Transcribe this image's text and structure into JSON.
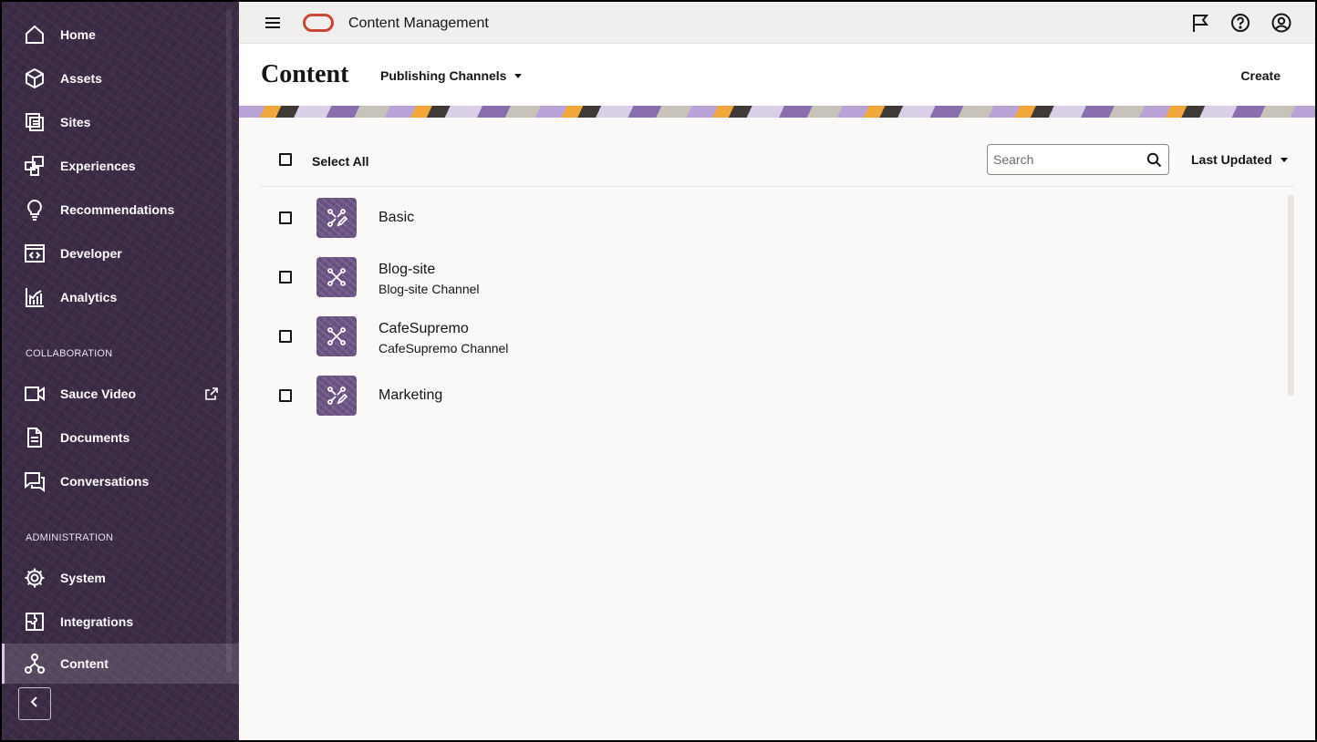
{
  "app": {
    "title": "Content Management"
  },
  "sidebar": {
    "items": [
      {
        "label": "Home",
        "icon": "home-icon"
      },
      {
        "label": "Assets",
        "icon": "cube-icon"
      },
      {
        "label": "Sites",
        "icon": "sites-icon"
      },
      {
        "label": "Experiences",
        "icon": "experiences-icon"
      },
      {
        "label": "Recommendations",
        "icon": "lightbulb-icon"
      },
      {
        "label": "Developer",
        "icon": "code-icon"
      },
      {
        "label": "Analytics",
        "icon": "bar-chart-icon"
      }
    ],
    "collaboration_header": "COLLABORATION",
    "collaboration": [
      {
        "label": "Sauce Video",
        "icon": "video-icon",
        "external": true
      },
      {
        "label": "Documents",
        "icon": "documents-icon"
      },
      {
        "label": "Conversations",
        "icon": "conversations-icon"
      }
    ],
    "administration_header": "ADMINISTRATION",
    "administration": [
      {
        "label": "System",
        "icon": "gear-icon"
      },
      {
        "label": "Integrations",
        "icon": "puzzle-icon"
      },
      {
        "label": "Content",
        "icon": "hierarchy-icon",
        "active": true
      }
    ]
  },
  "header": {
    "title": "Content",
    "view_selector": "Publishing Channels",
    "create_label": "Create"
  },
  "toolbar": {
    "select_all_label": "Select All",
    "search_placeholder": "Search",
    "search_value": "",
    "sort_label": "Last Updated"
  },
  "channels": [
    {
      "name": "Basic",
      "description": "",
      "icon": "channel-edit-icon"
    },
    {
      "name": "Blog-site",
      "description": "Blog-site Channel",
      "icon": "channel-icon"
    },
    {
      "name": "CafeSupremo",
      "description": "CafeSupremo Channel",
      "icon": "channel-icon"
    },
    {
      "name": "Marketing",
      "description": "",
      "icon": "channel-edit-icon"
    }
  ],
  "colors": {
    "sidebar_bg": "#3b2b45",
    "oracle_red": "#c74634",
    "thumb_bg": "#6b5384",
    "content_bg": "#faf9f8"
  }
}
